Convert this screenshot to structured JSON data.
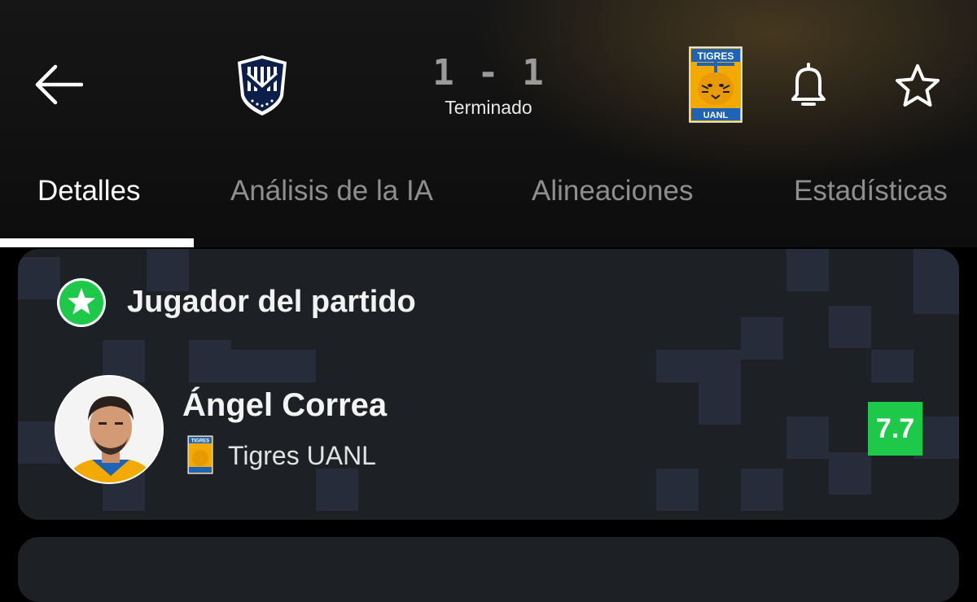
{
  "match": {
    "score": "1 - 1",
    "status": "Terminado",
    "home_team": {
      "crest": "monterrey-crest"
    },
    "away_team": {
      "crest_text_top": "TIGRES",
      "crest_text_bottom": "UANL"
    }
  },
  "header": {
    "back_icon": "arrow-left-icon",
    "notifications_icon": "bell-icon",
    "favorite_icon": "star-icon"
  },
  "tabs": [
    {
      "label": "Detalles",
      "active": true
    },
    {
      "label": "Análisis de la IA",
      "active": false
    },
    {
      "label": "Alineaciones",
      "active": false
    },
    {
      "label": "Estadísticas",
      "active": false
    }
  ],
  "player_of_match": {
    "title": "Jugador del partido",
    "badge_icon": "star-icon",
    "player_name": "Ángel Correa",
    "team_name": "Tigres UANL",
    "team_crest_text": "TIGRES",
    "rating": "7.7"
  },
  "colors": {
    "rating_green": "#1ec94a",
    "badge_green": "#1ec94a",
    "tigres_gold": "#f2a900",
    "tigres_blue": "#1d63b6",
    "monterrey_navy": "#0b1f4a"
  }
}
